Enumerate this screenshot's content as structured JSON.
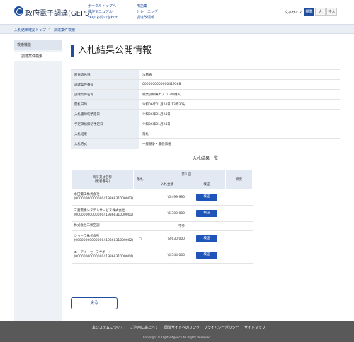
{
  "header": {
    "logo_text": "政府電子調達(GEPS)",
    "links": [
      "ポータルトップへ",
      "操作マニュアル",
      "FAQ･お問い合わせ",
      "用語集",
      "トレーニング",
      "調達改情報"
    ],
    "font_size_label": "文字サイズ",
    "font_sizes": [
      "標準",
      "大",
      "特大"
    ],
    "active_font_size": "標準"
  },
  "breadcrumb": [
    "入札結果確認トップ",
    "調達案件検索"
  ],
  "sidebar": {
    "heading": "検索機能",
    "items": [
      "調達案件検索"
    ]
  },
  "page_title": "入札結果公開情報",
  "info_rows": [
    {
      "label": "府省等名称",
      "value": "法務省"
    },
    {
      "label": "調達案件番号",
      "value": "0000000000000419368"
    },
    {
      "label": "調達案件名称",
      "value": "職業訓練棟エアコンの購入"
    },
    {
      "label": "開札日時",
      "value": "令和06年01月24日 13時30分"
    },
    {
      "label": "入札書締切予定日",
      "value": "令和06年01月24日"
    },
    {
      "label": "予定価格締切予定日",
      "value": "令和06年01月24日"
    },
    {
      "label": "入札結果",
      "value": "落札"
    },
    {
      "label": "入札方式",
      "value": "一般競争・最低価格"
    }
  ],
  "results_title": "入札結果一覧",
  "results": {
    "headers": {
      "vendor": "商号又は名称",
      "vendor_sub": "(業者番号)",
      "awarded": "落札",
      "round": "第１回",
      "amount": "入札金額",
      "verify": "検証",
      "summary": "摘要"
    },
    "rows": [
      {
        "name": "水田電工株式会社",
        "code": "(0000000000000041936831000003)",
        "awarded": "",
        "amount": "\\6,499,990",
        "verify": "検証",
        "summary": ""
      },
      {
        "name": "三菱電機システムサービス株式会社",
        "code": "(0000000000000041936831000001)",
        "awarded": "",
        "amount": "\\6,300,000",
        "verify": "検証",
        "summary": ""
      },
      {
        "name": "株式会社三栄空調",
        "code": "",
        "awarded": "",
        "amount": "不参",
        "verify": "",
        "summary": ""
      },
      {
        "name": "ショーワ株式会社",
        "code": "(0000000000000041936831000002)",
        "awarded": "○",
        "amount": "\\3,630,000",
        "verify": "検証",
        "summary": ""
      },
      {
        "name": "エーアイ・セーフサポート",
        "code": "(0000000000000041936831000004)",
        "awarded": "",
        "amount": "\\4,544,000",
        "verify": "検証",
        "summary": ""
      }
    ]
  },
  "back_label": "戻る",
  "footer": {
    "links": [
      "本システムについて",
      "ご利用にあたって",
      "関連サイトへのリンク",
      "プライバシーポリシー",
      "サイトマップ"
    ],
    "copyright": "Copyright © Digital Agency All Rights Reserved."
  }
}
